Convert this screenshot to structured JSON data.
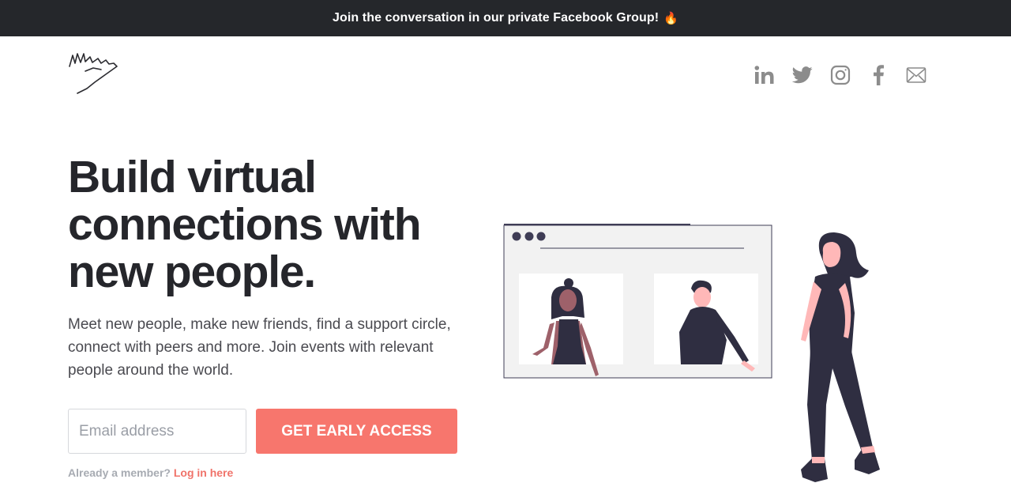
{
  "banner": {
    "text": "Join the conversation in our private Facebook Group!",
    "emoji": "🔥"
  },
  "logo": {
    "icon": "waving-hand-sketch-icon"
  },
  "socials": [
    {
      "name": "linkedin",
      "label": "in"
    },
    {
      "name": "twitter"
    },
    {
      "name": "instagram"
    },
    {
      "name": "facebook",
      "label": "f"
    },
    {
      "name": "email"
    }
  ],
  "hero": {
    "headline_line1": "Build virtual",
    "headline_line2": "connections with",
    "headline_line3": "new people.",
    "subtext": "Meet new people, make new friends, find a support circle, connect with peers and more. Join events with relevant people around the world."
  },
  "signup": {
    "email_placeholder": "Email address",
    "email_value": "",
    "cta_label": "GET EARLY ACCESS",
    "member_text": "Already a member?",
    "login_link": "Log in here"
  },
  "colors": {
    "banner_bg": "#25272b",
    "accent": "#f7766d",
    "heading": "#25262b",
    "icon_gray": "#8c8c8c"
  }
}
